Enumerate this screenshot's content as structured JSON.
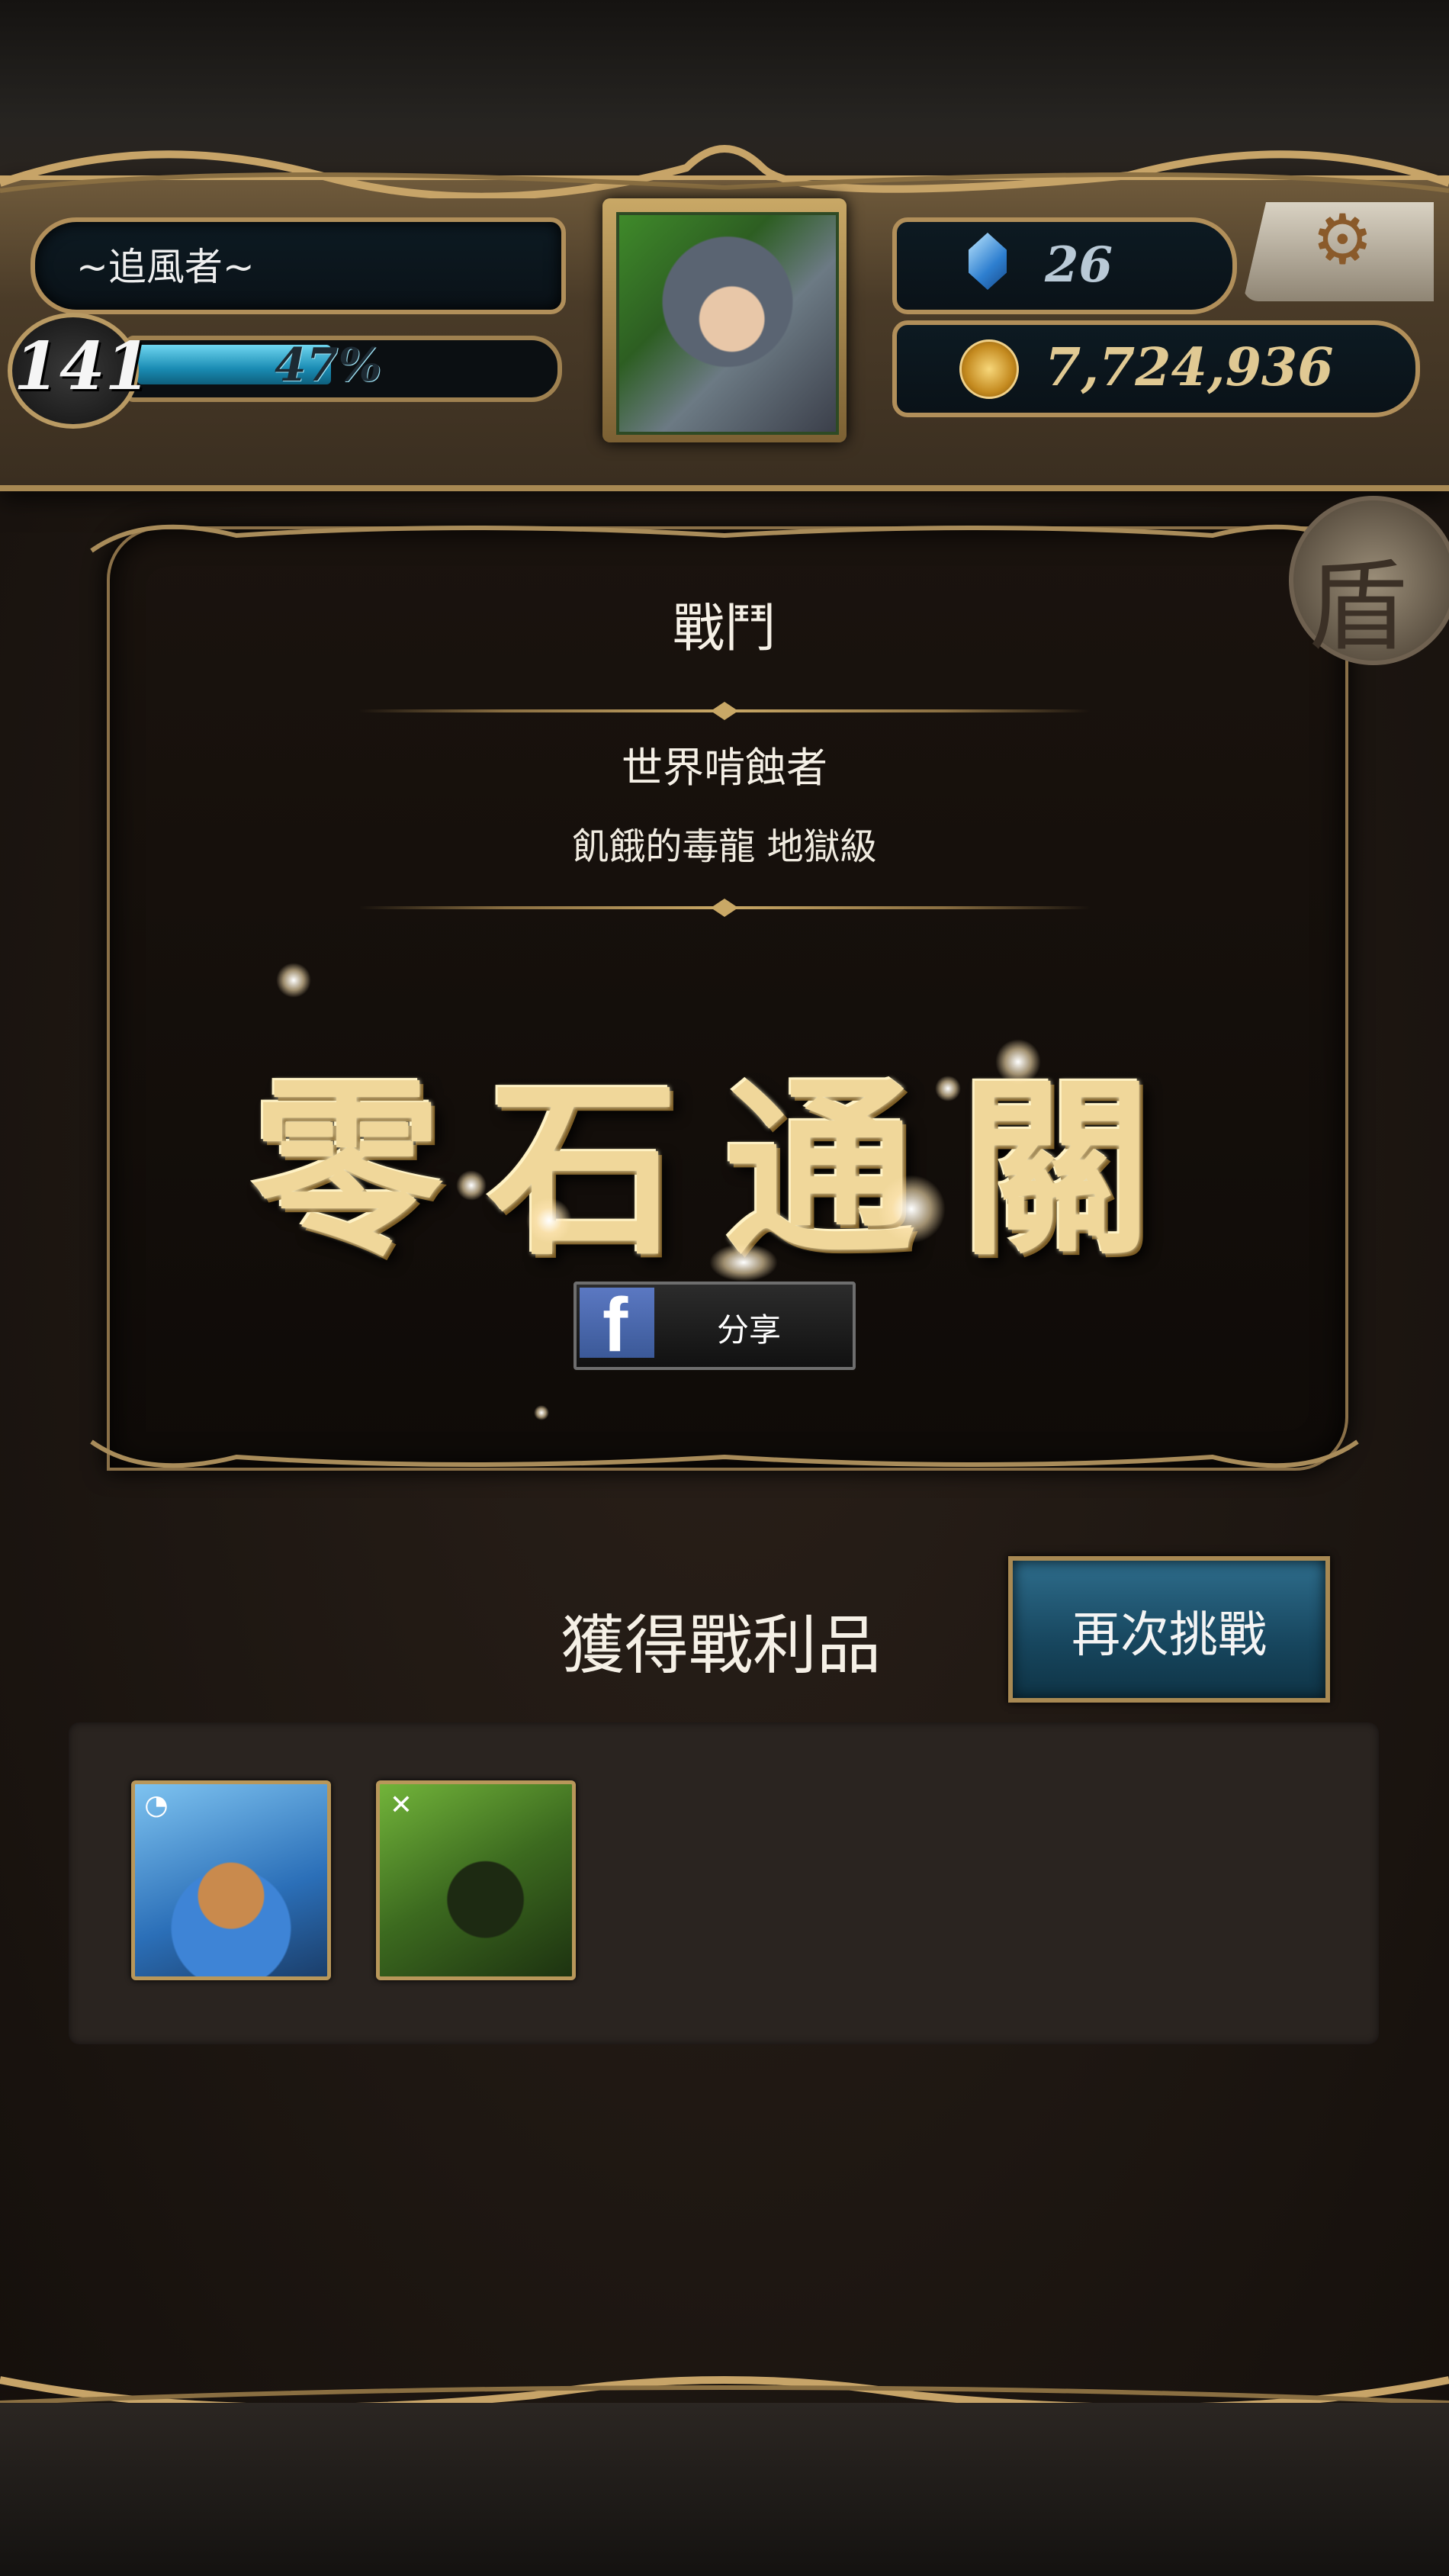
{
  "player": {
    "name": "~追風者~",
    "level": "141",
    "exp_percent_label": "47%",
    "exp_fraction": 0.47
  },
  "currency": {
    "gems": "26",
    "coins": "7,724,936"
  },
  "icons": {
    "settings": "gears-icon",
    "gem": "diamond-icon",
    "coin": "coin-icon",
    "side": "shield-icon",
    "share": "facebook-icon"
  },
  "battle": {
    "title": "戰鬥",
    "stage_name": "世界啃蝕者",
    "stage_sub": "飢餓的毒龍 地獄級",
    "achievement": "零石通關"
  },
  "share": {
    "fb_glyph": "f",
    "label": "分享"
  },
  "loot": {
    "title": "獲得戰利品",
    "retry_label": "再次挑戰",
    "items": [
      {
        "name": "water-dragon-card",
        "attribute": "water"
      },
      {
        "name": "wood-dragon-card",
        "attribute": "wood"
      }
    ]
  },
  "colors": {
    "accent_gold": "#c9a866",
    "exp_bar": "#1a8cb4",
    "retry_button": "#17465e",
    "facebook": "#3b5998"
  }
}
